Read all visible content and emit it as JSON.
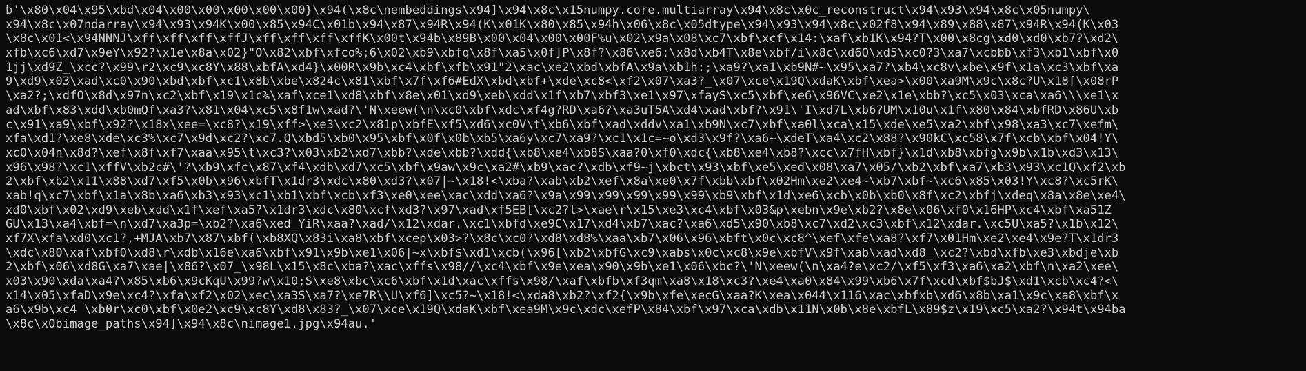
{
  "terminal": {
    "background": "#0c0c0c",
    "foreground": "#cccccc",
    "lines": [
      "b'\\x80\\x04\\x95\\xbd\\x04\\x00\\x00\\x00\\x00\\x00}\\x94(\\x8c\\nembeddings\\x94]\\x94\\x8c\\x15numpy.core.multiarray\\x94\\x8c\\x0c_reconstruct\\x94\\x93\\x94\\x8c\\x05numpy\\",
      "x94\\x8c\\x07ndarray\\x94\\x93\\x94K\\x00\\x85\\x94C\\x01b\\x94\\x87\\x94R\\x94(K\\x01K\\x80\\x85\\x94h\\x06\\x8c\\x05dtype\\x94\\x93\\x94\\x8c\\x02f8\\x94\\x89\\x88\\x87\\x94R\\x94(K\\x03",
      "\\x8c\\x01<\\x94NNNJ\\xff\\xff\\xff\\xffJ\\xff\\xff\\xff\\xffK\\x00t\\x94b\\x89B\\x00\\x04\\x00\\x00F%u\\x02\\x9a\\x08\\xc7\\xbf\\xcf\\x14:\\xaf\\xb1K\\x94?T\\x00\\x8cg\\xd0\\xd0\\xb7?\\xd2\\",
      "xfb\\xc6\\xd7\\x9eY\\x92?\\x1e\\x8a\\x02}\"O\\x82\\xbf\\xfco%;6\\x02\\xb9\\xbfq\\x8f\\xa5\\x0f]P\\x8f?\\x86\\xe6:\\x8d\\xb4T\\x8e\\xbf/i\\x8c\\xd6Q\\xd5\\xc0?3\\xa7\\xcbbb\\xf3\\xb1\\xbf\\x0",
      "1jj\\xd9Z_\\xcc?\\x99\\r2\\xc9\\xc8Y\\x88\\xbfA\\xd4}\\x00R\\x9b\\xc4\\xbf\\xfb\\x91\"2\\xac\\xe2\\xbd\\xbfA\\x9a\\xb1h:;\\xa9?\\xa1\\xb9N#~\\x95\\xa7?\\xb4\\xc8v\\xbe\\x9f\\x1a\\xc3\\xbf\\xa",
      "9\\xd9\\x03\\xad\\xc0\\x90\\xbd\\xbf\\xc1\\x8b\\xbe\\x824c\\x81\\xbf\\x7f\\xf6#EdX\\xbd\\xbf+\\xde\\xc8<\\xf2\\x07\\xa3?_\\x07\\xce\\x19Q\\xdaK\\xbf\\xea>\\x00\\xa9M\\x9c\\x8c?U\\x18[\\x08rP",
      "\\xa2?;\\xdfO\\x8d\\x97n\\xc2\\xbf\\x19\\x1c%\\xaf\\xce1\\xd8\\xbf\\x8e\\x01\\xd9\\xeb\\xdd\\x1f\\xb7\\xbf3\\xe1\\x97\\xfayS\\xc5\\xbf\\xe6\\x96VC\\xe2\\x1e\\xbb?\\xc5\\x03\\xca\\xa6\\\\\\xe1\\x",
      "ad\\xbf\\x83\\xdd\\xb0mQf\\xa3?\\x81\\x04\\xc5\\x8f1w\\xad?\\'N\\xeew(\\n\\xc0\\xbf\\xdc\\xf4g?RD\\xa6?\\xa3uT5A\\xd4\\xad\\xbf?\\x91\\'I\\xd7L\\xb6?UM\\x10u\\x1f\\x80\\x84\\xbfRD\\x86U\\xb",
      "c\\x91\\xa9\\xbf\\x92?\\x18x\\xee=\\xc8?\\x19\\xff>\\xe3\\xc2\\x81p\\xbfE\\xf5\\xd6\\xc0V\\t\\xb6\\xbf\\xad\\xddv\\xa1\\xb9N\\xc7\\xbf\\xa0l\\xca\\x15\\xde\\xe5\\xa2\\xbf\\x98\\xa3\\xc7\\xefm\\",
      "xfa\\xd1?\\xe8\\xde\\xc3%\\xc7\\x9d\\xc2?\\xc7.Q\\xbd5\\xb0\\x95\\xbf\\x0f\\x0b\\xb5\\xa6y\\xc7\\xa9?\\xc1\\x1c=~o\\xd3\\x9f?\\xa6~\\xdeT\\xa4\\xc2\\x88?\\x90kC\\xc58\\x7f\\xcb\\xbf\\x04!Y\\",
      "xc0\\x04n\\x8d?\\xef\\x8f\\xf7\\xaa\\x95\\t\\xc3?\\x03\\xb2\\xd7\\xbb?\\xde\\xbb?\\xdd{\\xb8\\xe4\\xb8S\\xaa?0\\xf0\\xdc{\\xb8\\xe4\\xb8?\\xcc\\x7fH\\xbf}\\x1d\\xb8\\xbfg\\x9b\\x1b\\xd3\\x13\\",
      "x96\\x98?\\xc1\\xffV\\xb2c#\\'?\\xb9\\xfc\\x87\\xf4\\xdb\\xd7\\xc5\\xbf\\x9aw\\x9c\\xa2#\\xb9\\xac?\\xdb\\xf9~j\\xbct\\x93\\xbf\\xe5\\xed\\x08\\xa7\\x05/\\xb2\\xbf\\xa7\\xb3\\x93\\xc1Q\\xf2\\xb",
      "2\\xbf\\xb2\\x11\\x88\\xd7\\xf5\\x0b\\x96\\xbfT\\x1dr3\\xdc\\x80\\xd3?\\x07|~\\x18!<\\xba?\\xab\\xb2\\xef\\x8a\\xe0\\x7f\\xbb\\xbf\\x02Hm\\xe2\\xe4~\\xb7\\xbf~\\xc6\\x85\\x03!Y\\xc8?\\xc5rK\\",
      "xab!q\\xc7\\xbf\\x1a\\x8b\\xa6\\xb3\\x93\\xc1\\xb1\\xbf\\xcb\\xf3\\xe0\\xee\\xac\\xdd\\xa6?\\x9a\\x99\\x99\\x99\\x99\\x99\\xb9\\xbf\\x1d\\xe6\\xcb\\x0b\\xb0\\x8f\\xc2\\xbfj\\xdeq\\x8a\\x8e\\xe4\\",
      "xd0\\xbf\\x02\\xd9\\xeb\\xdd\\x1f\\xef\\xa5?\\x1dr3\\xdc\\x80\\xcf\\xd3?\\x97\\xad\\xf5EB[\\xc2?l>\\xae\\r\\x15\\xe3\\xc4\\xbf\\x03&p\\xebn\\x9e\\xb2?\\x8e\\x06\\xf0\\x16HP\\xc4\\xbf\\xa51Z",
      "GU\\x13\\xa4\\xbf=\\n\\xd7\\xa3p=\\xb2?\\xa6\\xed_YiR\\xaa?\\xad/\\x12\\xdar.\\xc1\\xbfd\\xe9C\\x17\\xd4\\xb7\\xac?\\xa6\\xd5\\x90\\xb8\\xc7\\xd2\\xc3\\xbf\\x12\\xdar.\\xc5U\\xa5?\\x1b\\x12\\",
      "xf7X\\xfa\\xd0\\xc1?,+MJA\\xb7\\x87\\xbf(\\xb8XQ\\x83i\\xa8\\xbf\\xcep\\x03>?\\x8c\\xc0?\\xd8\\xd8%\\xaa\\xb7\\x06\\x96\\xbft\\x0c\\xc8^\\xef\\xfe\\xa8?\\xf7\\x01Hm\\xe2\\xe4\\x9e?T\\x1dr3",
      "\\xdc\\x80\\xaf\\xbf0\\xd8\\r\\xdb\\x16e\\xa6\\xbf\\x91\\x9b\\xe1\\x06|~x\\xbf$\\xd1\\xcb(\\x96[\\xb2\\xbfG\\xc9\\xabs\\x0c\\xc8\\x9e\\xbfV\\x9f\\xab\\xad\\xd8_\\xc2?\\xbd\\xfb\\xe3\\xbdje\\xb",
      "2\\xbf\\x06\\xd8G\\xa7\\xae|\\x86?\\x07_\\x98L\\x15\\x8c\\xba?\\xac\\xffs\\x98//\\xc4\\xbf\\x9e\\xea\\x90\\x9b\\xe1\\x06\\xbc?\\'N\\xeew(\\n\\xa4?e\\xc2/\\xf5\\xf3\\xa6\\xa2\\xbf\\n\\xa2\\xee\\",
      "x03\\x90\\xda\\xa4?\\x85\\xb6\\x9cKqU\\x99?w\\x10;S\\xe8\\xbc\\xc6\\xbf\\x1d\\xac\\xffs\\x98/\\xaf\\xbfb\\xf3qm\\xa8\\x18\\xc3?\\xe4\\xa0\\x84\\x99\\xb6\\x7f\\xcd\\xbf$bJ$\\xd1\\xcb\\xc4?<\\",
      "x14\\x05\\xfaD\\x9e\\xc4?\\xfa\\xf2\\x02\\xec\\xa3S\\xa7?\\xe7R\\\\U\\xf6]\\xc5?~\\x18!<\\xda8\\xb2?\\xf2{\\x9b\\xfe\\xecG\\xaa?K\\xea\\x044\\x116\\xac\\xbfxb\\xd6\\x8b\\xa1\\x9c\\xa8\\xbf\\x",
      "a6\\x9b\\xc4 \\xb0r\\xc0\\xbf\\x0e2\\xc9\\xc8Y\\xd8\\x83?_\\x07\\xce\\x19Q\\xdaK\\xbf\\xea9M\\x9c\\xdc\\xefP\\x84\\xbf\\x97\\xca\\xdb\\x11N\\x0b\\x8e\\xbfL\\x89$z\\x19\\xc5\\xa2?\\x94t\\x94ba",
      "\\x8c\\x0bimage_paths\\x94]\\x94\\x8c\\nimage1.jpg\\x94au.'"
    ]
  }
}
